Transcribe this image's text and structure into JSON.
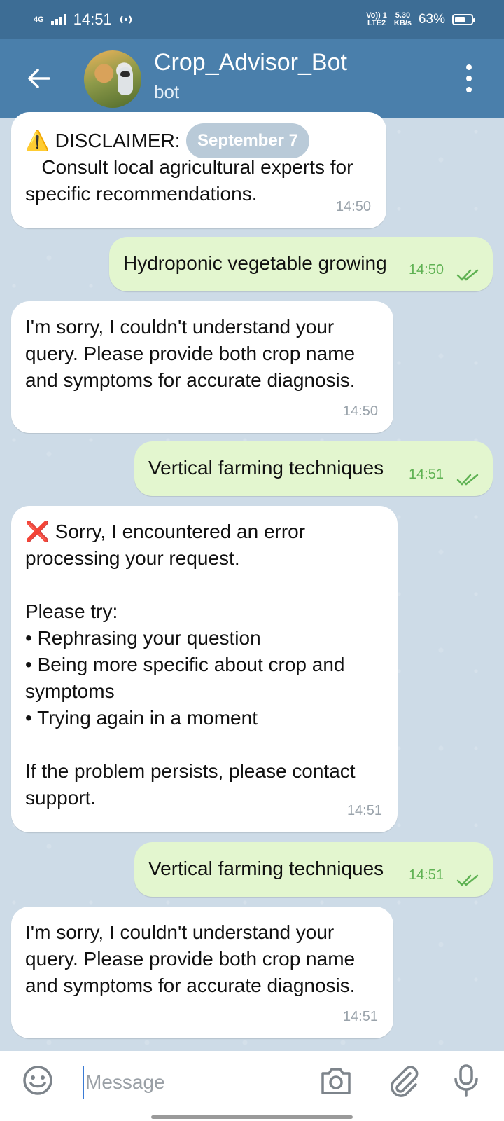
{
  "status_bar": {
    "network_type": "4G",
    "time": "14:51",
    "volte_top": "Vo)) 1",
    "volte_bottom": "LTE2",
    "speed_value": "5.30",
    "speed_unit": "KB/s",
    "battery_percent": "63%",
    "battery_level": 0.63
  },
  "header": {
    "title": "Crop_Advisor_Bot",
    "subtitle": "bot"
  },
  "date_pill": "September 7",
  "messages": [
    {
      "direction": "in",
      "text": "⚠️ DISCLAIMER:\n   Consult local agricultural experts for\nspecific recommendations.",
      "time": "14:50"
    },
    {
      "direction": "out",
      "text": "Hydroponic vegetable growing",
      "time": "14:50",
      "status": "read"
    },
    {
      "direction": "in",
      "text": "I'm sorry, I couldn't understand your\nquery. Please provide both crop name\nand symptoms for accurate diagnosis.",
      "time": "14:50"
    },
    {
      "direction": "out",
      "text": "Vertical farming techniques",
      "time": "14:51",
      "status": "read"
    },
    {
      "direction": "in",
      "text": "❌ Sorry, I encountered an error\nprocessing your request.\n\nPlease try:\n• Rephrasing your question\n• Being more specific about crop and\nsymptoms\n• Trying again in a moment\n\nIf the problem persists, please contact\nsupport.",
      "time": "14:51"
    },
    {
      "direction": "out",
      "text": "Vertical farming techniques",
      "time": "14:51",
      "status": "read"
    },
    {
      "direction": "in",
      "text": "I'm sorry, I couldn't understand your\nquery. Please provide both crop name\nand symptoms for accurate diagnosis.",
      "time": "14:51"
    }
  ],
  "input_bar": {
    "placeholder": "Message",
    "value": ""
  },
  "icons": {
    "back": "arrow-left-icon",
    "menu": "more-vertical-icon",
    "emoji": "smiley-icon",
    "camera": "camera-icon",
    "attach": "paperclip-icon",
    "mic": "microphone-icon",
    "read_receipt": "double-check-icon"
  },
  "colors": {
    "header": "#4a7fab",
    "status_bar": "#3d6d95",
    "outgoing_bubble": "#e3f6cf",
    "incoming_bubble": "#ffffff",
    "read_check": "#5fb253"
  }
}
